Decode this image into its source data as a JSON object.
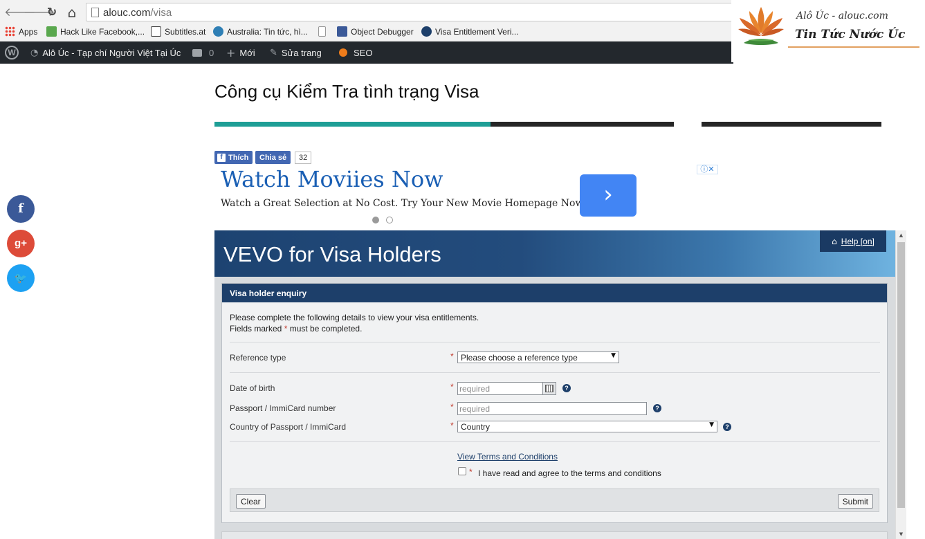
{
  "browser": {
    "back_glyph": "🡐",
    "forward_glyph": "🡒",
    "reload_glyph": "↻",
    "home_glyph": "⌂",
    "url_host": "alouc.com",
    "url_path": "/visa",
    "bookmarks": [
      {
        "label": "Apps",
        "icon": "apps-grid-icon",
        "color": "#e94235"
      },
      {
        "label": "Hack Like Facebook,...",
        "icon": "thumbs-up-icon",
        "color": "#5aa84e"
      },
      {
        "label": "Subtitles.at",
        "icon": "subtitles-icon",
        "color": "#444444"
      },
      {
        "label": "Australia: Tin tức, hì...",
        "icon": "globe-icon",
        "color": "#2f7fb5"
      },
      {
        "label": "",
        "icon": "blank-page-icon",
        "color": "#ffffff"
      },
      {
        "label": "Object Debugger",
        "icon": "facebook-icon",
        "color": "#3b5998"
      },
      {
        "label": "Visa Entitlement Veri...",
        "icon": "gear-icon",
        "color": "#1d3f6a"
      }
    ]
  },
  "adminbar": {
    "site_name": "Alô Úc - Tạp chí Người Việt Tại Úc",
    "comments_count": "0",
    "new_label": "Mới",
    "edit_label": "Sửa trang",
    "seo_label": "SEO"
  },
  "logo": {
    "tagline": "Alô Úc - alouc.com",
    "name": "Tin Tức Nước Úc"
  },
  "page": {
    "title": "Công cụ Kiểm Tra tình trạng Visa"
  },
  "social": {
    "like_label": "Thích",
    "share_label": "Chia sẻ",
    "count": "32",
    "share_circles": [
      {
        "glyph": "f",
        "color": "#3b5998",
        "icon": "facebook-icon"
      },
      {
        "glyph": "g+",
        "color": "#dd4b39",
        "icon": "google-plus-icon"
      },
      {
        "glyph": "🐦",
        "color": "#1da1f2",
        "icon": "twitter-icon"
      }
    ]
  },
  "ad": {
    "title": "Watch Moviies Now",
    "description": "Watch a Great Selection at No Cost. Try Your New Movie Homepage Now!",
    "arrow": "›",
    "choices": "ⓘ✕"
  },
  "vevo": {
    "title": "VEVO for Visa Holders",
    "help_label": "Help [on]",
    "form_heading": "Visa holder enquiry",
    "intro_line1": "Please complete the following details to view your visa entitlements.",
    "intro_line2_pre": "Fields marked ",
    "intro_line2_star": "*",
    "intro_line2_post": " must be completed.",
    "star": "*",
    "qmark": "?",
    "fields": {
      "reference_type_label": "Reference type",
      "reference_type_value": "Please choose a reference type",
      "dob_label": "Date of birth",
      "dob_placeholder": "required",
      "passport_label": "Passport / ImmiCard number",
      "passport_placeholder": "required",
      "country_label": "Country of Passport / ImmiCard",
      "country_value": "Country"
    },
    "terms_link": "View Terms and Conditions",
    "terms_agree": "I have read and agree to the terms and conditions",
    "clear_label": "Clear",
    "submit_label": "Submit"
  },
  "colors": {
    "accent_teal": "#1e9e96",
    "vevo_navy": "#1d3f6a",
    "ad_blue": "#4285f4"
  }
}
